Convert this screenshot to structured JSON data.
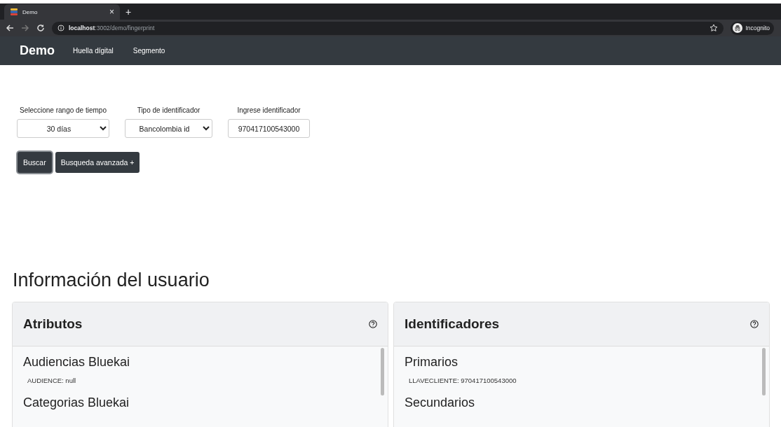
{
  "browser": {
    "tab": {
      "title": "Demo",
      "close": "×"
    },
    "new_tab": "+",
    "address": "**localhost**:3002/demo/fingerprint",
    "profile": "Incognito"
  },
  "navbar": {
    "brand": "Demo",
    "links": [
      "Huella dígital",
      "Segmento"
    ]
  },
  "filters": [
    {
      "kind": "select",
      "label": "Seleccione rango de tiempo",
      "value": "30 días"
    },
    {
      "kind": "select",
      "label": "Tipo de identificador",
      "value": "Bancolombia id"
    },
    {
      "kind": "input",
      "label": "Ingrese identificador",
      "value": "970417100543000"
    }
  ],
  "buttons": [
    {
      "label": "Buscar",
      "focused": true
    },
    {
      "label": "Busqueda avanzada +",
      "focused": false
    }
  ],
  "section_title": "Información del usuario",
  "cards": [
    {
      "title": "Atributos",
      "groups": [
        {
          "title": "Audiencias Bluekai",
          "lines": [
            "AUDIENCE: null"
          ]
        },
        {
          "title": "Categorias Bluekai"
        }
      ]
    },
    {
      "title": "Identificadores",
      "groups": [
        {
          "title": "Primarios",
          "lines": [
            "LLAVECLIENTE: 970417100543000"
          ]
        },
        {
          "title": "Secundarios"
        }
      ]
    }
  ]
}
